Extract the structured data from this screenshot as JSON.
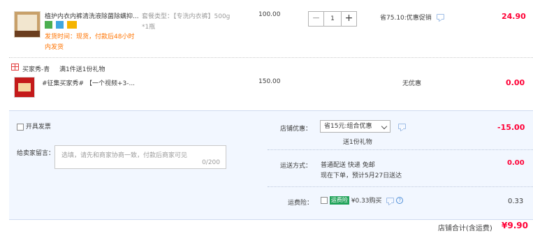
{
  "item1": {
    "title": "植护内衣内裤清洗液除菌除螨抑...",
    "delivery_line1": "发货时间：现货，付款后48小时",
    "delivery_line2": "内发货",
    "sku_label": "套餐类型：【专洗内衣裤】500g",
    "sku_qty": "*1瓶",
    "unit_price": "100.00",
    "quantity": "1",
    "minus": "−",
    "plus": "+",
    "discount": "省75.10:优惠促销",
    "total": "24.90"
  },
  "gift": {
    "header_label": "买家秀-青",
    "header_promo": "满1件送1份礼物",
    "title": "#征集买家秀# 【一个视频+3-...",
    "unit_price": "150.00",
    "discount": "无优惠",
    "total": "0.00"
  },
  "footer": {
    "invoice_label": "开具发票",
    "message_label": "给卖家留言：",
    "message_placeholder": "选填，请先和商家协商一致，付款后商家可见",
    "message_count": "0/200",
    "shop_discount_label": "店铺优惠：",
    "shop_discount_value": "省15元:组合优惠",
    "shop_discount_note": "送1份礼物",
    "shop_discount_amount": "-15.00",
    "shipping_label": "运送方式：",
    "shipping_method": "普通配送 快递 免邮",
    "shipping_eta": "现在下单，预计5月27日送达",
    "shipping_amount": "0.00",
    "insurance_label": "运费险：",
    "insurance_badge": "运费险",
    "insurance_price": "¥0.33购买",
    "insurance_amount": "0.33",
    "shop_total_label": "店铺合计(含运费)",
    "shop_total": "¥9.90"
  },
  "colors": {
    "price_red": "#ff0036",
    "delivery_orange": "#ff7300",
    "footer_bg": "#f2f7ff"
  }
}
